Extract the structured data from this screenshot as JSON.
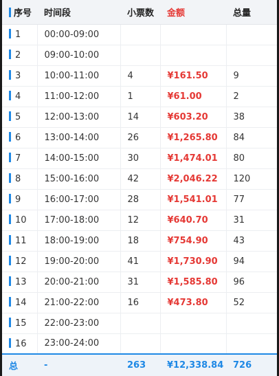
{
  "header": {
    "index": "序号",
    "time_slot": "时间段",
    "tickets": "小票数",
    "amount": "金额",
    "total": "总量"
  },
  "rows": [
    {
      "index": "1",
      "time_slot": "00:00-09:00",
      "tickets": "",
      "amount": "",
      "total": ""
    },
    {
      "index": "2",
      "time_slot": "09:00-10:00",
      "tickets": "",
      "amount": "",
      "total": ""
    },
    {
      "index": "3",
      "time_slot": "10:00-11:00",
      "tickets": "4",
      "amount": "¥161.50",
      "total": "9"
    },
    {
      "index": "4",
      "time_slot": "11:00-12:00",
      "tickets": "1",
      "amount": "¥61.00",
      "total": "2"
    },
    {
      "index": "5",
      "time_slot": "12:00-13:00",
      "tickets": "14",
      "amount": "¥603.20",
      "total": "38"
    },
    {
      "index": "6",
      "time_slot": "13:00-14:00",
      "tickets": "26",
      "amount": "¥1,265.80",
      "total": "84"
    },
    {
      "index": "7",
      "time_slot": "14:00-15:00",
      "tickets": "30",
      "amount": "¥1,474.01",
      "total": "80"
    },
    {
      "index": "8",
      "time_slot": "15:00-16:00",
      "tickets": "42",
      "amount": "¥2,046.22",
      "total": "120"
    },
    {
      "index": "9",
      "time_slot": "16:00-17:00",
      "tickets": "28",
      "amount": "¥1,541.01",
      "total": "77"
    },
    {
      "index": "10",
      "time_slot": "17:00-18:00",
      "tickets": "12",
      "amount": "¥640.70",
      "total": "31"
    },
    {
      "index": "11",
      "time_slot": "18:00-19:00",
      "tickets": "18",
      "amount": "¥754.90",
      "total": "43"
    },
    {
      "index": "12",
      "time_slot": "19:00-20:00",
      "tickets": "41",
      "amount": "¥1,730.90",
      "total": "94"
    },
    {
      "index": "13",
      "time_slot": "20:00-21:00",
      "tickets": "31",
      "amount": "¥1,585.80",
      "total": "96"
    },
    {
      "index": "14",
      "time_slot": "21:00-22:00",
      "tickets": "16",
      "amount": "¥473.80",
      "total": "52"
    },
    {
      "index": "15",
      "time_slot": "22:00-23:00",
      "tickets": "",
      "amount": "",
      "total": ""
    },
    {
      "index": "16",
      "time_slot": "23:00-24:00",
      "tickets": "",
      "amount": "",
      "total": ""
    }
  ],
  "footer": {
    "index": "总",
    "time_slot": "-",
    "tickets": "263",
    "amount": "¥12,338.84",
    "total": "726"
  },
  "colors": {
    "accent_blue": "#1e88e5",
    "amount_red": "#e53935",
    "header_bg": "#f2f4f7",
    "footer_bg": "#eef3f9"
  }
}
